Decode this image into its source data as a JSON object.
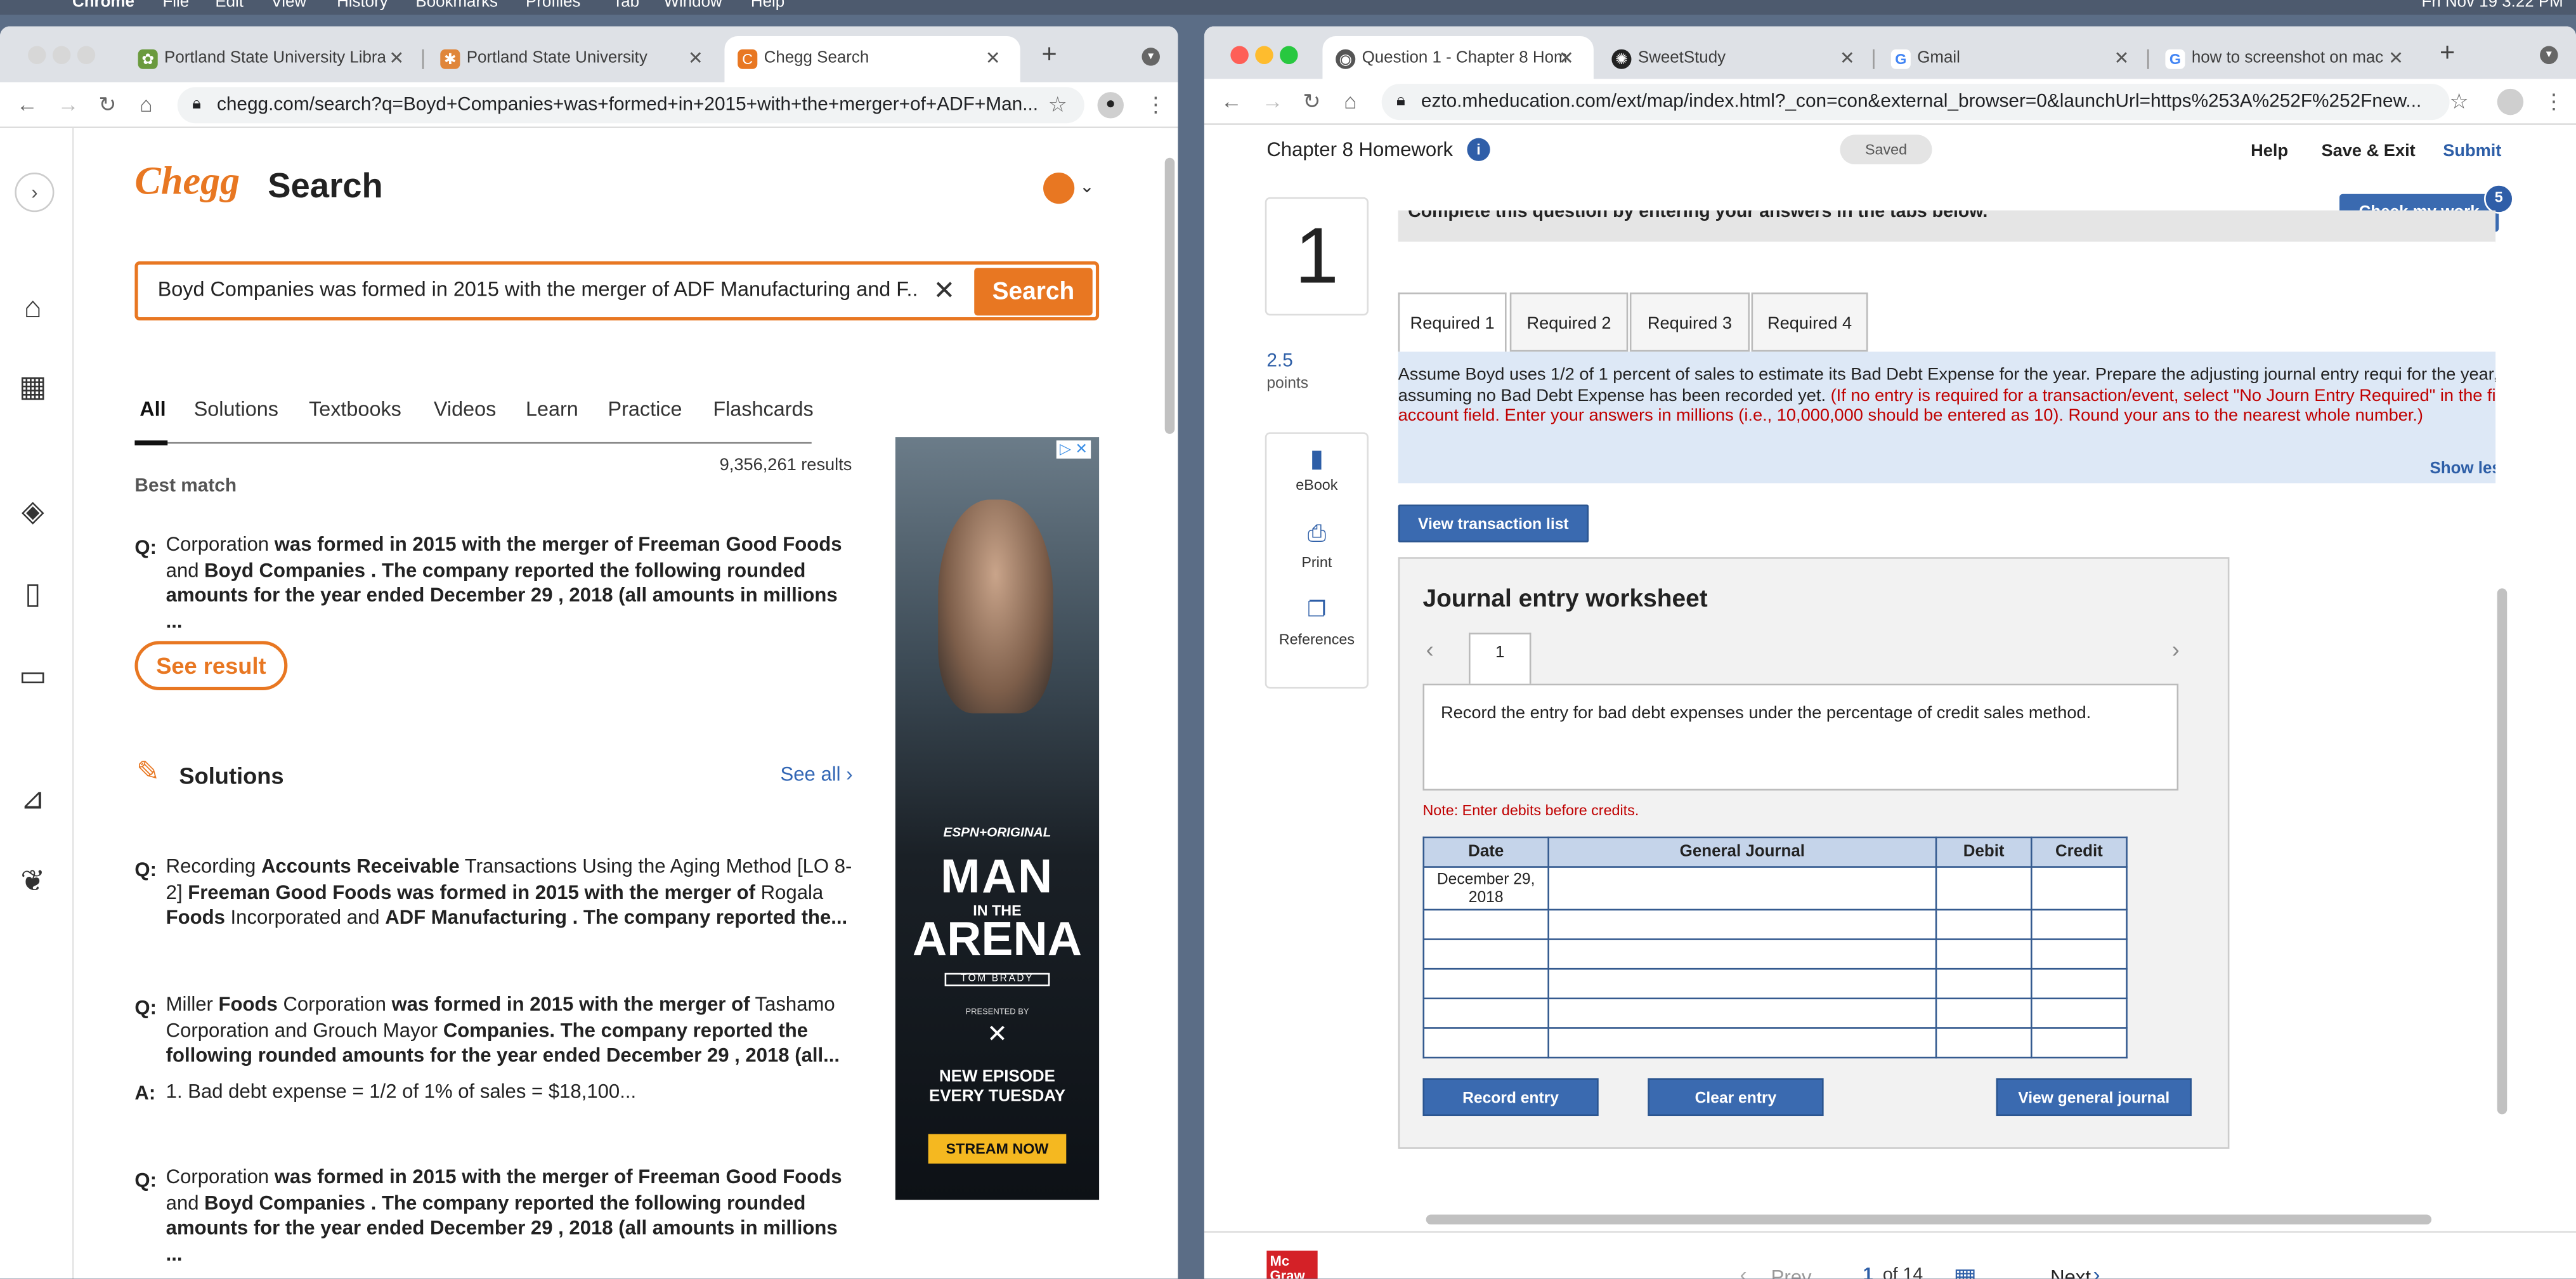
{
  "menubar": {
    "app": "Chrome",
    "items": [
      "File",
      "Edit",
      "View",
      "History",
      "Bookmarks",
      "Profiles",
      "Tab",
      "Window",
      "Help"
    ],
    "clock": "Fri Nov 19  3:22 PM"
  },
  "left_window": {
    "tabs": [
      "Portland State University Libra",
      "Portland State University",
      "Chegg Search"
    ],
    "url": "chegg.com/search?q=Boyd+Companies+was+formed+in+2015+with+the+merger+of+ADF+Man...",
    "chegg": {
      "logo": "Chegg",
      "page_title": "Search",
      "search_value": "Boyd Companies was formed in 2015 with the merger of ADF Manufacturing and F...",
      "search_button": "Search",
      "filters": [
        "All",
        "Solutions",
        "Textbooks",
        "Videos",
        "Learn",
        "Practice",
        "Flashcards"
      ],
      "results_count": "9,356,261 results",
      "best_match_label": "Best match",
      "best_match_q": "Q:",
      "see_result": "See result",
      "solutions_title": "Solutions",
      "see_all": "See all ›",
      "q_label": "Q:",
      "a_label": "A:",
      "answer2": "1. Bad debt expense = 1/2 of 1% of sales = $18,100..."
    },
    "ad": {
      "brand": "ESPN+ORIGINAL",
      "title1": "MAN",
      "title2": "IN THE",
      "title3": "ARENA",
      "sub": "TOM BRADY",
      "presented": "PRESENTED BY",
      "episode": "NEW EPISODE EVERY TUESDAY",
      "cta": "STREAM NOW"
    }
  },
  "right_window": {
    "tabs": [
      "Question 1 - Chapter 8 Hom",
      "SweetStudy",
      "Gmail",
      "how to screenshot on mac"
    ],
    "url": "ezto.mheducation.com/ext/map/index.html?_con=con&external_browser=0&launchUrl=https%253A%252F%252Fnew...",
    "header": {
      "title": "Chapter 8 Homework",
      "saved": "Saved",
      "help": "Help",
      "save_exit": "Save & Exit",
      "submit": "Submit",
      "check": "Check my work",
      "check_badge": "5"
    },
    "question_no": "1",
    "points": "2.5",
    "points_label": "points",
    "side": [
      "eBook",
      "Print",
      "References"
    ],
    "instructions_head": "Complete this question by entering your answers in the tabs below.",
    "req_tabs": [
      "Required 1",
      "Required 2",
      "Required 3",
      "Required 4"
    ],
    "prompt_black": "Assume Boyd uses 1/2 of 1 percent of sales to estimate its Bad Debt Expense for the year. Prepare the adjusting journal entry requi for the year, assuming no Bad Debt Expense has been recorded yet.",
    "prompt_red": "(If no entry is required for a transaction/event, select \"No Journ Entry Required\" in the first account field. Enter your answers in millions (i.e., 10,000,000 should be entered as 10). Round your ans to the nearest whole number.)",
    "show_less": "Show les",
    "view_tx": "View transaction list",
    "worksheet_title": "Journal entry worksheet",
    "entry_tab": "1",
    "entry_desc": "Record the entry for bad debt expenses under the percentage of credit sales method.",
    "note": "Note: Enter debits before credits.",
    "table": {
      "headers": [
        "Date",
        "General Journal",
        "Debit",
        "Credit"
      ],
      "first_date": "December 29, 2018"
    },
    "buttons": [
      "Record entry",
      "Clear entry",
      "View general journal"
    ],
    "footer": {
      "prev": "Prev",
      "page": "1",
      "of": "of 14",
      "next": "Next",
      "logo": "Mc Graw Hill"
    }
  }
}
